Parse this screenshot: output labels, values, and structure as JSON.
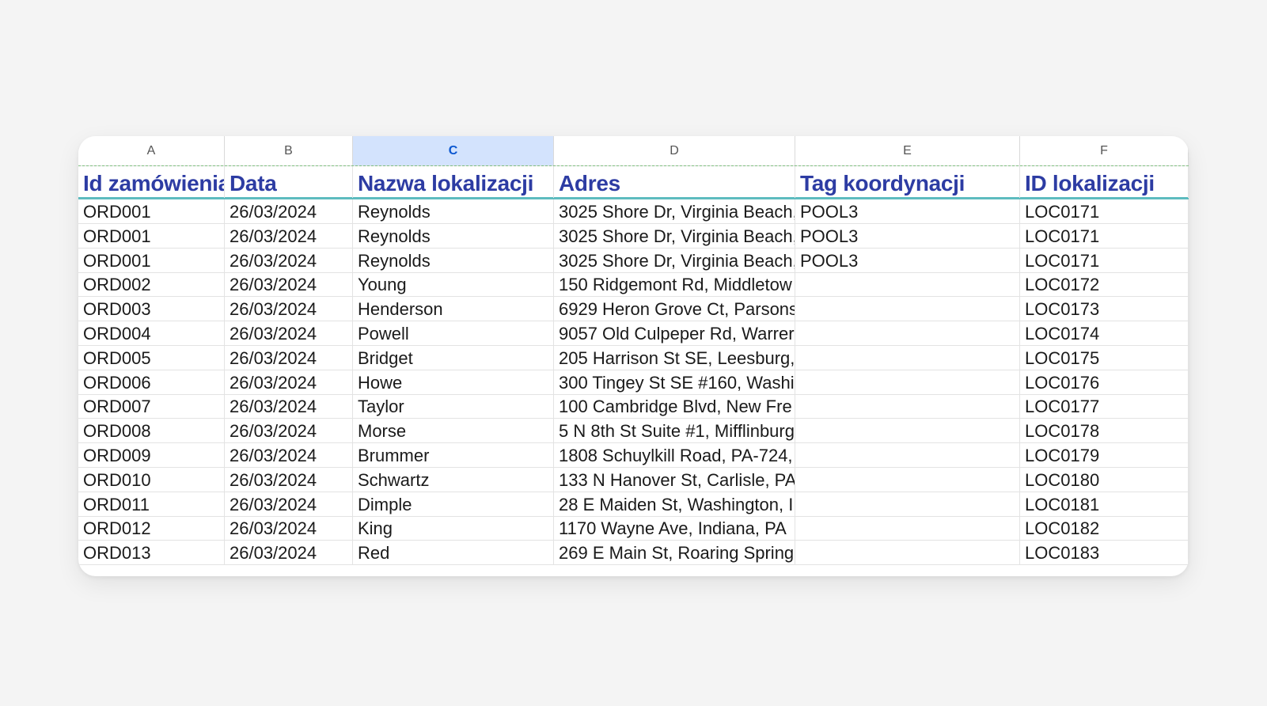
{
  "sheet": {
    "column_letters": [
      "A",
      "B",
      "C",
      "D",
      "E",
      "F"
    ],
    "selected_column": "C",
    "headers": [
      "Id zamówienia",
      "Data",
      "Nazwa lokalizacji",
      "Adres",
      "Tag koordynacji",
      "ID lokalizacji"
    ],
    "rows": [
      [
        "ORD001",
        "26/03/2024",
        "Reynolds",
        "3025 Shore Dr, Virginia Beach,",
        "POOL3",
        "LOC0171"
      ],
      [
        "ORD001",
        "26/03/2024",
        "Reynolds",
        "3025 Shore Dr, Virginia Beach,",
        "POOL3",
        "LOC0171"
      ],
      [
        "ORD001",
        "26/03/2024",
        "Reynolds",
        "3025 Shore Dr, Virginia Beach,",
        "POOL3",
        "LOC0171"
      ],
      [
        "ORD002",
        "26/03/2024",
        "Young",
        "150 Ridgemont Rd, Middletow",
        "",
        "LOC0172"
      ],
      [
        "ORD003",
        "26/03/2024",
        "Henderson",
        "6929 Heron Grove Ct, Parsons",
        "",
        "LOC0173"
      ],
      [
        "ORD004",
        "26/03/2024",
        "Powell",
        "9057 Old Culpeper Rd, Warrer",
        "",
        "LOC0174"
      ],
      [
        "ORD005",
        "26/03/2024",
        "Bridget",
        "205 Harrison St SE, Leesburg,",
        "",
        "LOC0175"
      ],
      [
        "ORD006",
        "26/03/2024",
        "Howe",
        "300 Tingey St SE #160, Washi",
        "",
        "LOC0176"
      ],
      [
        "ORD007",
        "26/03/2024",
        "Taylor",
        "100 Cambridge Blvd, New Fre",
        "",
        "LOC0177"
      ],
      [
        "ORD008",
        "26/03/2024",
        "Morse",
        "5 N 8th St Suite #1, Mifflinburg",
        "",
        "LOC0178"
      ],
      [
        "ORD009",
        "26/03/2024",
        "Brummer",
        "1808 Schuylkill Road, PA-724,",
        "",
        "LOC0179"
      ],
      [
        "ORD010",
        "26/03/2024",
        "Schwartz",
        "133 N Hanover St, Carlisle, PA",
        "",
        "LOC0180"
      ],
      [
        "ORD011",
        "26/03/2024",
        "Dimple",
        "28 E Maiden St, Washington, I",
        "",
        "LOC0181"
      ],
      [
        "ORD012",
        "26/03/2024",
        "King",
        "1170 Wayne Ave, Indiana, PA",
        "",
        "LOC0182"
      ],
      [
        "ORD013",
        "26/03/2024",
        "Red",
        "269 E Main St, Roaring Spring",
        "",
        "LOC0183"
      ]
    ]
  }
}
